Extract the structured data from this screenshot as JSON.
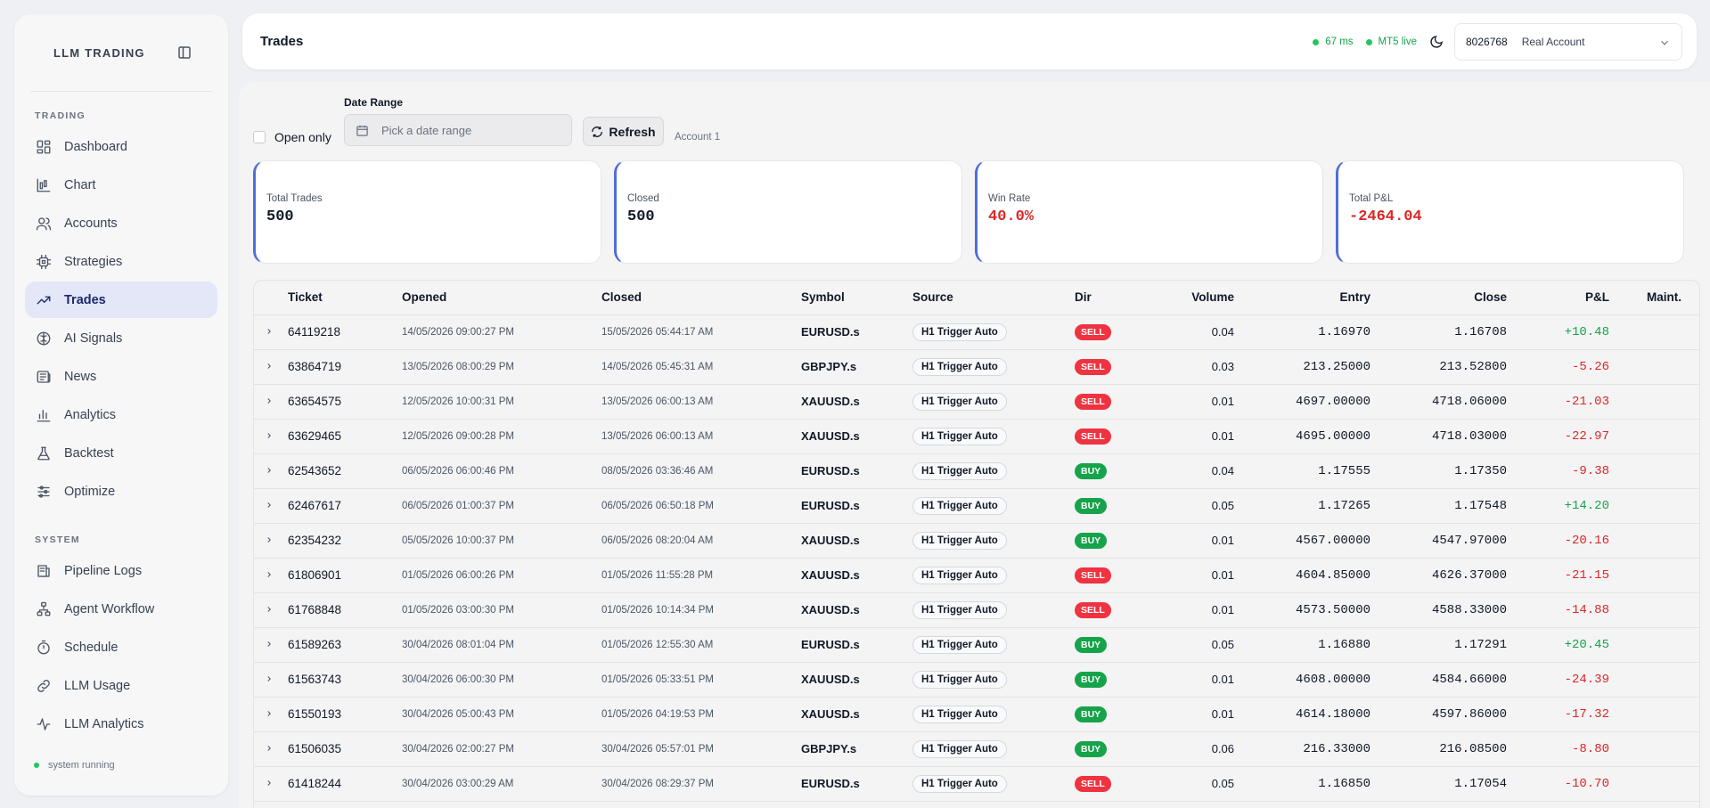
{
  "app": {
    "brand": "LLM TRADING",
    "status": "system running"
  },
  "sidebar": {
    "trading_label": "TRADING",
    "system_label": "SYSTEM",
    "trading_items": [
      {
        "label": "Dashboard",
        "icon": "dashboard-icon"
      },
      {
        "label": "Chart",
        "icon": "chart-icon"
      },
      {
        "label": "Accounts",
        "icon": "accounts-icon"
      },
      {
        "label": "Strategies",
        "icon": "chip-icon"
      },
      {
        "label": "Trades",
        "icon": "trending-icon",
        "active": true
      },
      {
        "label": "AI Signals",
        "icon": "brain-icon"
      },
      {
        "label": "News",
        "icon": "newspaper-icon"
      },
      {
        "label": "Analytics",
        "icon": "bar-chart-icon"
      },
      {
        "label": "Backtest",
        "icon": "flask-icon"
      },
      {
        "label": "Optimize",
        "icon": "sliders-icon"
      }
    ],
    "system_items": [
      {
        "label": "Pipeline Logs",
        "icon": "logs-icon"
      },
      {
        "label": "Agent Workflow",
        "icon": "workflow-icon"
      },
      {
        "label": "Schedule",
        "icon": "timer-icon"
      },
      {
        "label": "LLM Usage",
        "icon": "link-icon"
      },
      {
        "label": "LLM Analytics",
        "icon": "activity-icon"
      }
    ]
  },
  "header": {
    "title": "Trades",
    "latency": "67 ms",
    "feed": "MT5 live",
    "account_number": "8026768",
    "account_type": "Real Account"
  },
  "filters": {
    "open_only_label": "Open only",
    "date_range_label": "Date Range",
    "date_placeholder": "Pick a date range",
    "refresh_label": "Refresh",
    "account_tag": "Account 1"
  },
  "stats": [
    {
      "label": "Total Trades",
      "value": "500",
      "negative": false
    },
    {
      "label": "Closed",
      "value": "500",
      "negative": false
    },
    {
      "label": "Win Rate",
      "value": "40.0%",
      "negative": true
    },
    {
      "label": "Total P&L",
      "value": "-2464.04",
      "negative": true
    }
  ],
  "table": {
    "columns": [
      "Ticket",
      "Opened",
      "Closed",
      "Symbol",
      "Source",
      "Dir",
      "Volume",
      "Entry",
      "Close",
      "P&L",
      "Maint."
    ],
    "rows": [
      {
        "ticket": "64119218",
        "opened": "14/05/2026 09:00:27 PM",
        "closed": "15/05/2026 05:44:17 AM",
        "symbol": "EURUSD.s",
        "source": "H1 Trigger Auto",
        "dir": "SELL",
        "volume": "0.04",
        "entry": "1.16970",
        "close": "1.16708",
        "pnl": "+10.48"
      },
      {
        "ticket": "63864719",
        "opened": "13/05/2026 08:00:29 PM",
        "closed": "14/05/2026 05:45:31 AM",
        "symbol": "GBPJPY.s",
        "source": "H1 Trigger Auto",
        "dir": "SELL",
        "volume": "0.03",
        "entry": "213.25000",
        "close": "213.52800",
        "pnl": "-5.26"
      },
      {
        "ticket": "63654575",
        "opened": "12/05/2026 10:00:31 PM",
        "closed": "13/05/2026 06:00:13 AM",
        "symbol": "XAUUSD.s",
        "source": "H1 Trigger Auto",
        "dir": "SELL",
        "volume": "0.01",
        "entry": "4697.00000",
        "close": "4718.06000",
        "pnl": "-21.03"
      },
      {
        "ticket": "63629465",
        "opened": "12/05/2026 09:00:28 PM",
        "closed": "13/05/2026 06:00:13 AM",
        "symbol": "XAUUSD.s",
        "source": "H1 Trigger Auto",
        "dir": "SELL",
        "volume": "0.01",
        "entry": "4695.00000",
        "close": "4718.03000",
        "pnl": "-22.97"
      },
      {
        "ticket": "62543652",
        "opened": "06/05/2026 06:00:46 PM",
        "closed": "08/05/2026 03:36:46 AM",
        "symbol": "EURUSD.s",
        "source": "H1 Trigger Auto",
        "dir": "BUY",
        "volume": "0.04",
        "entry": "1.17555",
        "close": "1.17350",
        "pnl": "-9.38"
      },
      {
        "ticket": "62467617",
        "opened": "06/05/2026 01:00:37 PM",
        "closed": "06/05/2026 06:50:18 PM",
        "symbol": "EURUSD.s",
        "source": "H1 Trigger Auto",
        "dir": "BUY",
        "volume": "0.05",
        "entry": "1.17265",
        "close": "1.17548",
        "pnl": "+14.20"
      },
      {
        "ticket": "62354232",
        "opened": "05/05/2026 10:00:37 PM",
        "closed": "06/05/2026 08:20:04 AM",
        "symbol": "XAUUSD.s",
        "source": "H1 Trigger Auto",
        "dir": "BUY",
        "volume": "0.01",
        "entry": "4567.00000",
        "close": "4547.97000",
        "pnl": "-20.16"
      },
      {
        "ticket": "61806901",
        "opened": "01/05/2026 06:00:26 PM",
        "closed": "01/05/2026 11:55:28 PM",
        "symbol": "XAUUSD.s",
        "source": "H1 Trigger Auto",
        "dir": "SELL",
        "volume": "0.01",
        "entry": "4604.85000",
        "close": "4626.37000",
        "pnl": "-21.15"
      },
      {
        "ticket": "61768848",
        "opened": "01/05/2026 03:00:30 PM",
        "closed": "01/05/2026 10:14:34 PM",
        "symbol": "XAUUSD.s",
        "source": "H1 Trigger Auto",
        "dir": "SELL",
        "volume": "0.01",
        "entry": "4573.50000",
        "close": "4588.33000",
        "pnl": "-14.88"
      },
      {
        "ticket": "61589263",
        "opened": "30/04/2026 08:01:04 PM",
        "closed": "01/05/2026 12:55:30 AM",
        "symbol": "EURUSD.s",
        "source": "H1 Trigger Auto",
        "dir": "BUY",
        "volume": "0.05",
        "entry": "1.16880",
        "close": "1.17291",
        "pnl": "+20.45"
      },
      {
        "ticket": "61563743",
        "opened": "30/04/2026 06:00:30 PM",
        "closed": "01/05/2026 05:33:51 PM",
        "symbol": "XAUUSD.s",
        "source": "H1 Trigger Auto",
        "dir": "BUY",
        "volume": "0.01",
        "entry": "4608.00000",
        "close": "4584.66000",
        "pnl": "-24.39"
      },
      {
        "ticket": "61550193",
        "opened": "30/04/2026 05:00:43 PM",
        "closed": "01/05/2026 04:19:53 PM",
        "symbol": "XAUUSD.s",
        "source": "H1 Trigger Auto",
        "dir": "BUY",
        "volume": "0.01",
        "entry": "4614.18000",
        "close": "4597.86000",
        "pnl": "-17.32"
      },
      {
        "ticket": "61506035",
        "opened": "30/04/2026 02:00:27 PM",
        "closed": "30/04/2026 05:57:01 PM",
        "symbol": "GBPJPY.s",
        "source": "H1 Trigger Auto",
        "dir": "BUY",
        "volume": "0.06",
        "entry": "216.33000",
        "close": "216.08500",
        "pnl": "-8.80"
      },
      {
        "ticket": "61418244",
        "opened": "30/04/2026 03:00:29 AM",
        "closed": "30/04/2026 08:29:37 PM",
        "symbol": "EURUSD.s",
        "source": "H1 Trigger Auto",
        "dir": "SELL",
        "volume": "0.05",
        "entry": "1.16850",
        "close": "1.17054",
        "pnl": "-10.70"
      }
    ]
  }
}
